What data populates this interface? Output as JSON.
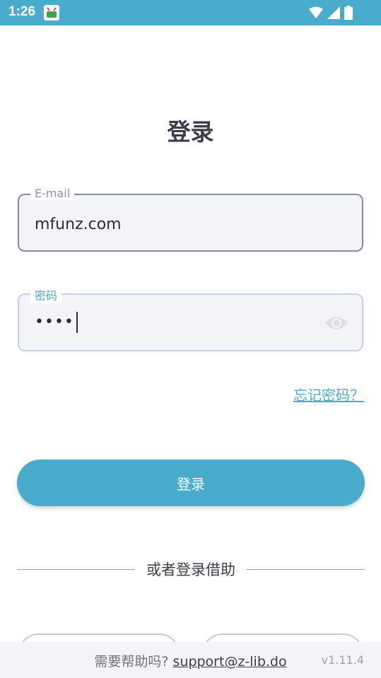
{
  "status_bar": {
    "time": "1:26"
  },
  "login": {
    "title": "登录",
    "email_label": "E-mail",
    "email_value": "mfunz.com",
    "password_label": "密码",
    "password_value": "••••",
    "forgot_label": "忘记密码？",
    "submit_label": "登录",
    "alt_label": "或者登录借助"
  },
  "footer": {
    "help_text": "需要帮助吗?",
    "support_email": "support@z-lib.do",
    "version": "v1.11.4"
  },
  "colors": {
    "accent": "#4aaccd",
    "text": "#3a3d4a"
  }
}
